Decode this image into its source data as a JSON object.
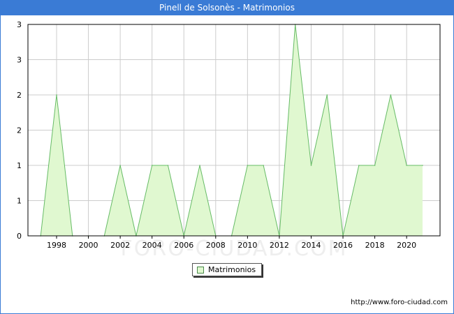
{
  "title": "Pinell de Solsonès - Matrimonios",
  "watermark": "FORO-CIUDAD.COM",
  "source_url": "http://www.foro-ciudad.com",
  "colors": {
    "titlebar": "#3a7bd5",
    "area_fill": "#e0f8d0",
    "area_line": "#66bb66",
    "grid": "#cccccc"
  },
  "chart_data": {
    "type": "area",
    "title": "Pinell de Solsonès - Matrimonios",
    "x": [
      1997,
      1998,
      1999,
      2000,
      2001,
      2002,
      2003,
      2004,
      2005,
      2006,
      2007,
      2008,
      2009,
      2010,
      2011,
      2012,
      2013,
      2014,
      2015,
      2016,
      2017,
      2018,
      2019,
      2020,
      2021
    ],
    "series": [
      {
        "name": "Matrimonios",
        "values": [
          0,
          2,
          0,
          0,
          0,
          1,
          0,
          1,
          1,
          0,
          1,
          0,
          0,
          1,
          1,
          0,
          3,
          1,
          2,
          0,
          1,
          1,
          2,
          1,
          1
        ]
      }
    ],
    "xticks": [
      "1998",
      "2000",
      "2002",
      "2004",
      "2006",
      "2008",
      "2010",
      "2012",
      "2014",
      "2016",
      "2018",
      "2020"
    ],
    "yticks": [
      "0",
      "1",
      "1",
      "2",
      "2",
      "3",
      "3"
    ],
    "ylim": [
      0,
      3
    ],
    "grid": true,
    "legend": "bottom-center"
  }
}
